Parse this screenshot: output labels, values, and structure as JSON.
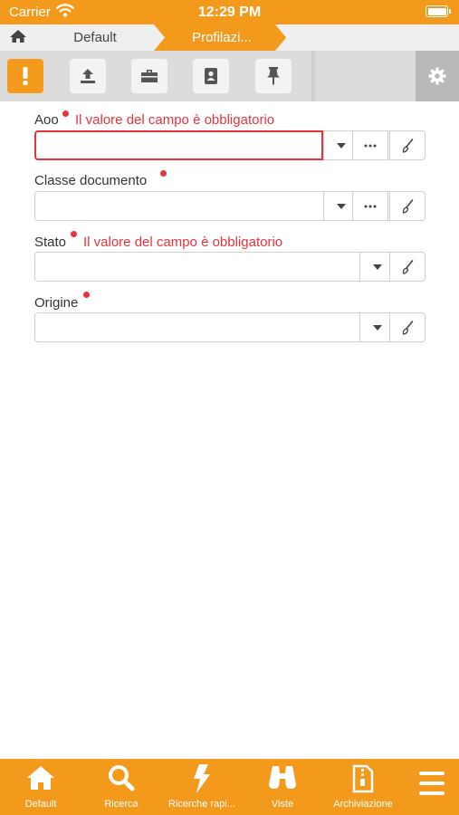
{
  "status_bar": {
    "carrier": "Carrier",
    "time": "12:29 PM",
    "battery_level": 1.0
  },
  "breadcrumb": {
    "items": [
      {
        "label": "Default"
      },
      {
        "label": "Profilazi..."
      }
    ]
  },
  "toolbar": {
    "buttons": [
      {
        "icon": "exclamation-icon",
        "active": true
      },
      {
        "icon": "upload-icon",
        "active": false
      },
      {
        "icon": "briefcase-icon",
        "active": false
      },
      {
        "icon": "address-book-icon",
        "active": false
      },
      {
        "icon": "pin-icon",
        "active": false
      }
    ],
    "settings_icon": "gear-icon"
  },
  "form": {
    "fields": [
      {
        "label": "Aoo",
        "required": true,
        "error": "Il valore del campo è obbligatorio",
        "value": "",
        "addons": [
          "dropdown",
          "more",
          "clear"
        ]
      },
      {
        "label": "Classe documento",
        "required": true,
        "error": "",
        "value": "",
        "addons": [
          "dropdown",
          "more",
          "clear"
        ]
      },
      {
        "label": "Stato",
        "required": true,
        "error": "Il valore del campo è obbligatorio",
        "value": "",
        "addons": [
          "dropdown",
          "clear"
        ]
      },
      {
        "label": "Origine",
        "required": true,
        "error": "",
        "value": "",
        "addons": [
          "dropdown",
          "clear"
        ]
      }
    ]
  },
  "tabbar": {
    "tabs": [
      {
        "label": "Default",
        "icon": "home-icon"
      },
      {
        "label": "Ricerca",
        "icon": "search-icon"
      },
      {
        "label": "Ricerche rapi...",
        "icon": "lightning-icon"
      },
      {
        "label": "Viste",
        "icon": "binoculars-icon"
      },
      {
        "label": "Archiviazione",
        "icon": "archive-icon"
      },
      {
        "label": "",
        "icon": "menu-icon"
      }
    ]
  },
  "colors": {
    "accent": "#f39a1d",
    "error": "#e8323c",
    "toolbar": "#dcdcdc"
  }
}
